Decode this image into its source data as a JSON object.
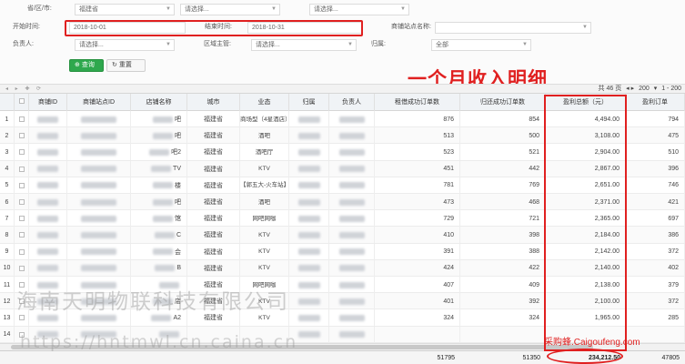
{
  "filters": {
    "province_label": "省/区/市:",
    "province_value": "福建省",
    "city_value": "请选择...",
    "district_value": "请选择...",
    "start_label": "开始时间:",
    "start_value": "2018-10-01",
    "end_label": "结束时间:",
    "end_value": "2018-10-31",
    "merchant_label": "商铺站点名称:",
    "person_label": "负责人:",
    "person_value": "请选择...",
    "manager_label": "区域主管:",
    "manager_value": "请选择...",
    "ownership_label": "归属:",
    "ownership_value": "全部"
  },
  "buttons": {
    "query": "查询",
    "reset": "重置"
  },
  "annotation": "一个月收入明细",
  "pager": {
    "total_text": "共 46 页",
    "page_size": "200",
    "range": "1 - 200"
  },
  "columns": [
    "商铺ID",
    "商铺站点ID",
    "店铺名称",
    "城市",
    "业态",
    "归属",
    "负责人",
    "租借成功订单数",
    "归还成功订单数",
    "盈利总额（元）",
    "盈利订单"
  ],
  "rows": [
    {
      "no": "1",
      "name": "吧",
      "city": "福建省",
      "type": "商场型（4星酒店）",
      "rent": "876",
      "ret": "854",
      "profit": "4,494.00",
      "last": "794"
    },
    {
      "no": "2",
      "name": "吧",
      "city": "福建省",
      "type": "酒吧",
      "rent": "513",
      "ret": "500",
      "profit": "3,108.00",
      "last": "475"
    },
    {
      "no": "3",
      "name": "吧2",
      "city": "福建省",
      "type": "酒吧厅",
      "rent": "523",
      "ret": "521",
      "profit": "2,904.00",
      "last": "510"
    },
    {
      "no": "4",
      "name": "TV",
      "city": "福建省",
      "type": "KTV",
      "rent": "451",
      "ret": "442",
      "profit": "2,867.00",
      "last": "396"
    },
    {
      "no": "5",
      "name": "楼",
      "city": "福建省",
      "type": "【郭五大-火车站】",
      "rent": "781",
      "ret": "769",
      "profit": "2,651.00",
      "last": "746"
    },
    {
      "no": "6",
      "name": "吧",
      "city": "福建省",
      "type": "酒吧",
      "rent": "473",
      "ret": "468",
      "profit": "2,371.00",
      "last": "421"
    },
    {
      "no": "7",
      "name": "馆",
      "city": "福建省",
      "type": "网吧网咖",
      "rent": "729",
      "ret": "721",
      "profit": "2,365.00",
      "last": "697"
    },
    {
      "no": "8",
      "name": "C",
      "city": "福建省",
      "type": "KTV",
      "rent": "410",
      "ret": "398",
      "profit": "2,184.00",
      "last": "386"
    },
    {
      "no": "9",
      "name": "会",
      "city": "福建省",
      "type": "KTV",
      "rent": "391",
      "ret": "388",
      "profit": "2,142.00",
      "last": "372"
    },
    {
      "no": "10",
      "name": "B",
      "city": "福建省",
      "type": "KTV",
      "rent": "424",
      "ret": "422",
      "profit": "2,140.00",
      "last": "402"
    },
    {
      "no": "11",
      "name": "",
      "city": "福建省",
      "type": "网吧网咖",
      "rent": "407",
      "ret": "409",
      "profit": "2,138.00",
      "last": "379"
    },
    {
      "no": "12",
      "name": "店",
      "city": "福建省",
      "type": "KTV",
      "rent": "401",
      "ret": "392",
      "profit": "2,100.00",
      "last": "372"
    },
    {
      "no": "13",
      "name": "A2",
      "city": "福建省",
      "type": "KTV",
      "rent": "324",
      "ret": "324",
      "profit": "1,965.00",
      "last": "285"
    },
    {
      "no": "14",
      "name": "",
      "city": "",
      "type": "",
      "rent": "",
      "ret": "",
      "profit": "",
      "last": ""
    }
  ],
  "totals": {
    "rent": "51795",
    "ret": "51350",
    "profit": "234,212.50",
    "last": "47805"
  },
  "watermarks": {
    "company": "海南天明物联科技有限公司",
    "url": "https://hntmwl.cn.caina.cn",
    "source": "采购蜂.Caigoufeng.com"
  },
  "colors": {
    "accent_red": "#e02020",
    "query_green": "#2ea84d"
  }
}
